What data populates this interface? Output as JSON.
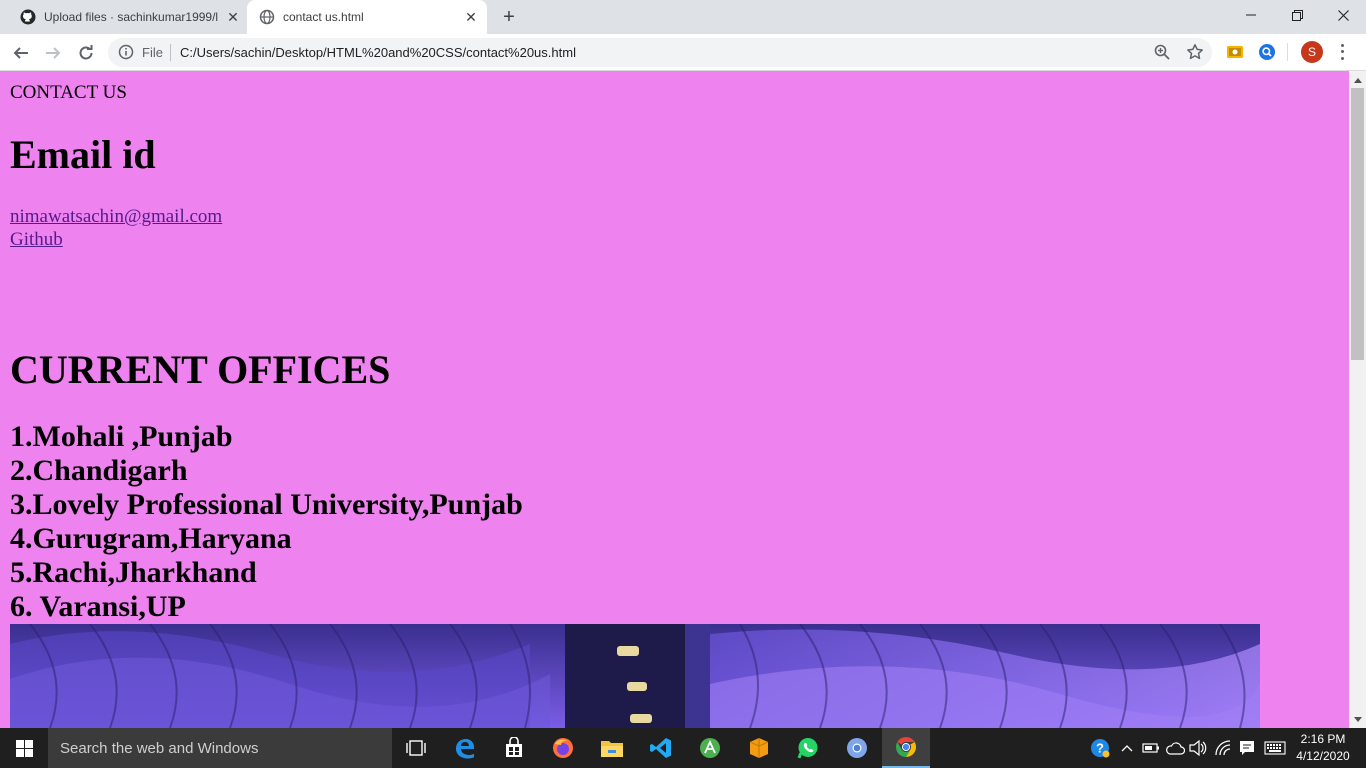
{
  "browser": {
    "tabs": [
      {
        "title": "Upload files · sachinkumar1999/l",
        "active": false
      },
      {
        "title": "contact us.html",
        "active": true
      }
    ],
    "scheme": "File",
    "url": "C:/Users/sachin/Desktop/HTML%20and%20CSS/contact%20us.html",
    "profile_initial": "S"
  },
  "page": {
    "top_heading": "CONTACT US",
    "email_heading": "Email id",
    "email_link": "nimawatsachin@gmail.com",
    "github_link": "Github",
    "offices_heading": "CURRENT OFFICES",
    "offices": [
      "1.Mohali ,Punjab",
      "2.Chandigarh",
      "3.Lovely Professional University,Punjab",
      "4.Gurugram,Haryana",
      "5.Rachi,Jharkhand",
      "6. Varansi,UP"
    ],
    "background_color": "#ee82ee",
    "link_color": "#551a8b"
  },
  "taskbar": {
    "search_placeholder": "Search the web and Windows",
    "time": "2:16 PM",
    "date": "4/12/2020",
    "apps": [
      "task-view",
      "edge",
      "store",
      "firefox",
      "file-explorer",
      "vscode",
      "android-studio",
      "package",
      "whatsapp",
      "chromium",
      "chrome"
    ]
  }
}
